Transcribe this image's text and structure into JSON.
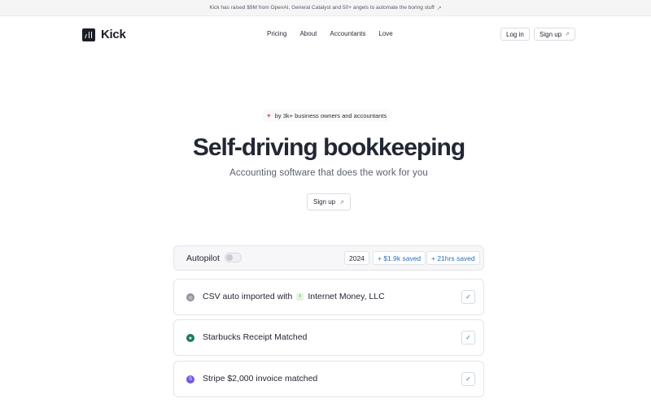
{
  "announcement": {
    "text": "Kick has raised $9M from OpenAI, General Catalyst and 50+ angels to automate the boring stuff",
    "arrow": "↗"
  },
  "nav": {
    "brand": "Kick",
    "links": [
      "Pricing",
      "About",
      "Accountants",
      "Love"
    ],
    "login": "Log in",
    "signup": "Sign up"
  },
  "hero": {
    "badge": "by 3k+ business owners and accountants",
    "title": "Self-driving bookkeeping",
    "subtitle": "Accounting software that does the work for you",
    "cta": "Sign up"
  },
  "autopilot": {
    "label": "Autopilot",
    "enabled": false,
    "year": "2024",
    "saved_money": "+ $1.9k saved",
    "saved_time": "+ 21hrs saved"
  },
  "activity": [
    {
      "text": "CSV auto imported with",
      "extra": "Internet Money, LLC",
      "icon": "csv-import-icon",
      "color": "#8f949e"
    },
    {
      "text": "Starbucks Receipt Matched",
      "icon": "starbucks-icon",
      "color": "#1e7a55"
    },
    {
      "text": "Stripe $2,000 invoice matched",
      "icon": "stripe-icon",
      "color": "#6a5be2"
    }
  ],
  "colors": {
    "accent": "#2f6fb8",
    "heart": "#e06a9a"
  }
}
